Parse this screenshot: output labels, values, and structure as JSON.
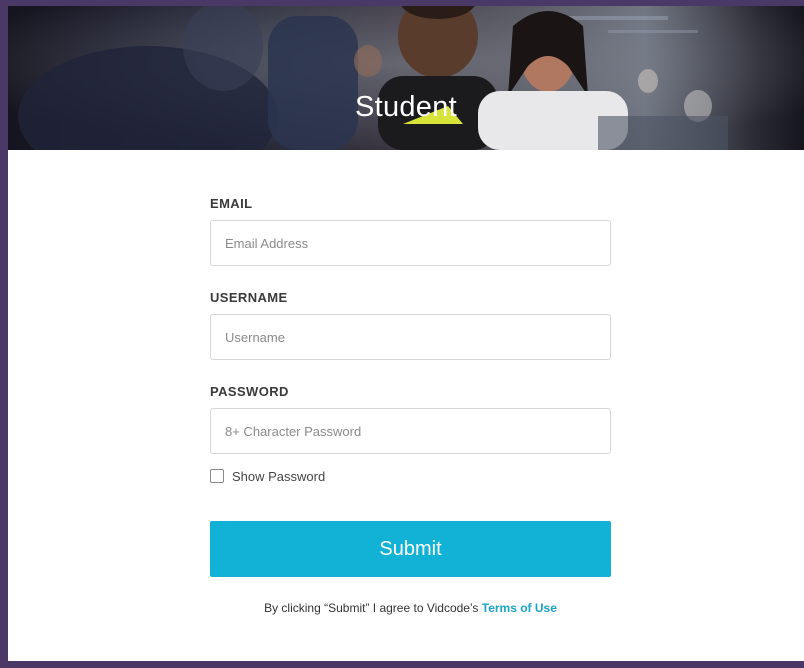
{
  "header": {
    "title": "Student"
  },
  "form": {
    "email": {
      "label": "EMAIL",
      "placeholder": "Email Address",
      "value": ""
    },
    "username": {
      "label": "USERNAME",
      "placeholder": "Username",
      "value": ""
    },
    "password": {
      "label": "PASSWORD",
      "placeholder": "8+ Character Password",
      "value": ""
    },
    "show_password": {
      "label": "Show Password",
      "checked": false
    },
    "submit_label": "Submit",
    "terms_text": "By clicking “Submit” I agree to Vidcode’s",
    "terms_link": "Terms of Use"
  },
  "colors": {
    "accent": "#12b1d6",
    "link": "#1aa3c8",
    "page_border": "#4a3866"
  }
}
